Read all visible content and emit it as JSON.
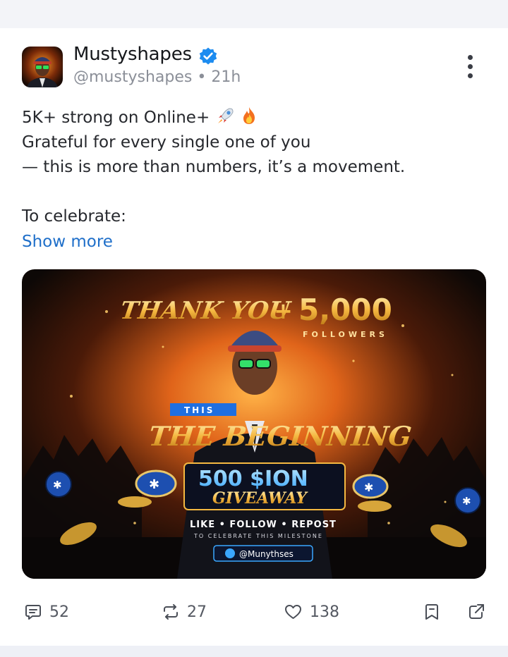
{
  "post": {
    "author_name": "Mustyshapes",
    "handle": "@mustyshapes",
    "separator": "•",
    "time": "21h",
    "lines": [
      "5K+ strong on Online+",
      "Grateful for every single one of you",
      "— this is more than numbers, it’s a movement.",
      "",
      "To celebrate:"
    ],
    "emojis": [
      "rocket-emoji",
      "fire-emoji"
    ],
    "show_more": "Show more"
  },
  "image": {
    "thank_you": "THANK YOU",
    "plus": "+",
    "count": "5,000",
    "followers": "FOLLOWERS",
    "this": "THIS",
    "beginning": "THE BEGINNING",
    "amount": "500 $ION",
    "giveaway": "GIVEAWAY",
    "cta": "LIKE • FOLLOW • REPOST",
    "subtitle": "TO CELEBRATE THIS MILESTONE",
    "tag": "@Munythses"
  },
  "actions": {
    "comments": "52",
    "reposts": "27",
    "likes": "138"
  },
  "colors": {
    "link": "#1f6fc9",
    "verified": "#1d8cf0",
    "gold": "#f5b841",
    "ion_blue": "#3aa7ff"
  },
  "icons": [
    "verified-badge-icon",
    "more-options-icon",
    "comment-icon",
    "repost-icon",
    "heart-icon",
    "bookmark-icon",
    "share-icon"
  ]
}
